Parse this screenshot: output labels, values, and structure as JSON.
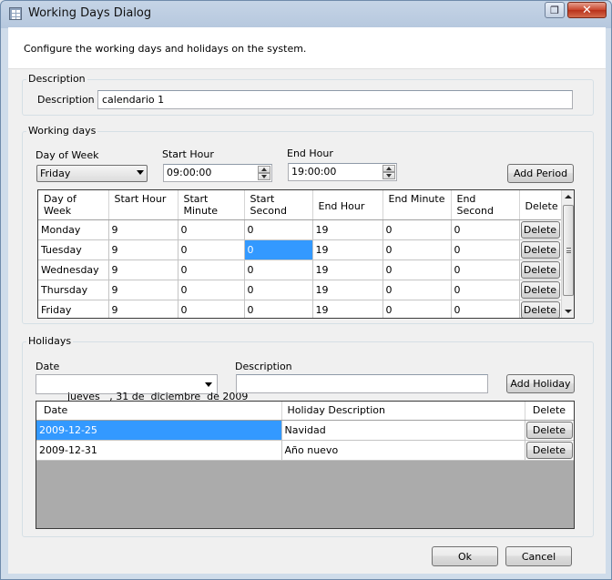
{
  "window": {
    "title": "Working Days Dialog",
    "close_glyph": "✕",
    "restore_glyph": "❐"
  },
  "header": {
    "text": "Configure the working days and holidays on the system."
  },
  "description_group": {
    "legend": "Description",
    "label": "Description",
    "value": "calendario 1"
  },
  "working_days": {
    "legend": "Working days",
    "day_of_week_label": "Day of Week",
    "day_of_week_value": "Friday",
    "start_hour_label": "Start Hour",
    "start_hour_value": "09:00:00",
    "end_hour_label": "End Hour",
    "end_hour_value": "19:00:00",
    "add_period_label": "Add Period",
    "columns": [
      "Day of Week",
      "Start Hour",
      "Start Minute",
      "Start Second",
      "End Hour",
      "End Minute",
      "End Second",
      "Delete"
    ],
    "rows": [
      {
        "day": "Monday",
        "start_hour": "9",
        "start_minute": "0",
        "start_second": "0",
        "end_hour": "19",
        "end_minute": "0",
        "end_second": "0",
        "delete": "Delete"
      },
      {
        "day": "Tuesday",
        "start_hour": "9",
        "start_minute": "0",
        "start_second": "0",
        "end_hour": "19",
        "end_minute": "0",
        "end_second": "0",
        "delete": "Delete"
      },
      {
        "day": "Wednesday",
        "start_hour": "9",
        "start_minute": "0",
        "start_second": "0",
        "end_hour": "19",
        "end_minute": "0",
        "end_second": "0",
        "delete": "Delete"
      },
      {
        "day": "Thursday",
        "start_hour": "9",
        "start_minute": "0",
        "start_second": "0",
        "end_hour": "19",
        "end_minute": "0",
        "end_second": "0",
        "delete": "Delete"
      },
      {
        "day": "Friday",
        "start_hour": "9",
        "start_minute": "0",
        "start_second": "0",
        "end_hour": "19",
        "end_minute": "0",
        "end_second": "0",
        "delete": "Delete"
      }
    ]
  },
  "holidays": {
    "legend": "Holidays",
    "date_label": "Date",
    "date_value": "jueves   , 31 de  diciembre  de 2009",
    "description_label": "Description",
    "description_value": "",
    "add_holiday_label": "Add Holiday",
    "columns": [
      "Date",
      "Holiday Description",
      "Delete"
    ],
    "rows": [
      {
        "date": "2009-12-25",
        "description": "Navidad",
        "delete": "Delete"
      },
      {
        "date": "2009-12-31",
        "description": "Año nuevo",
        "delete": "Delete"
      }
    ]
  },
  "footer": {
    "ok_label": "Ok",
    "cancel_label": "Cancel"
  },
  "colors": {
    "selection": "#3399ff",
    "window_frame": "#b6c8de",
    "close_button": "#c8442b"
  }
}
